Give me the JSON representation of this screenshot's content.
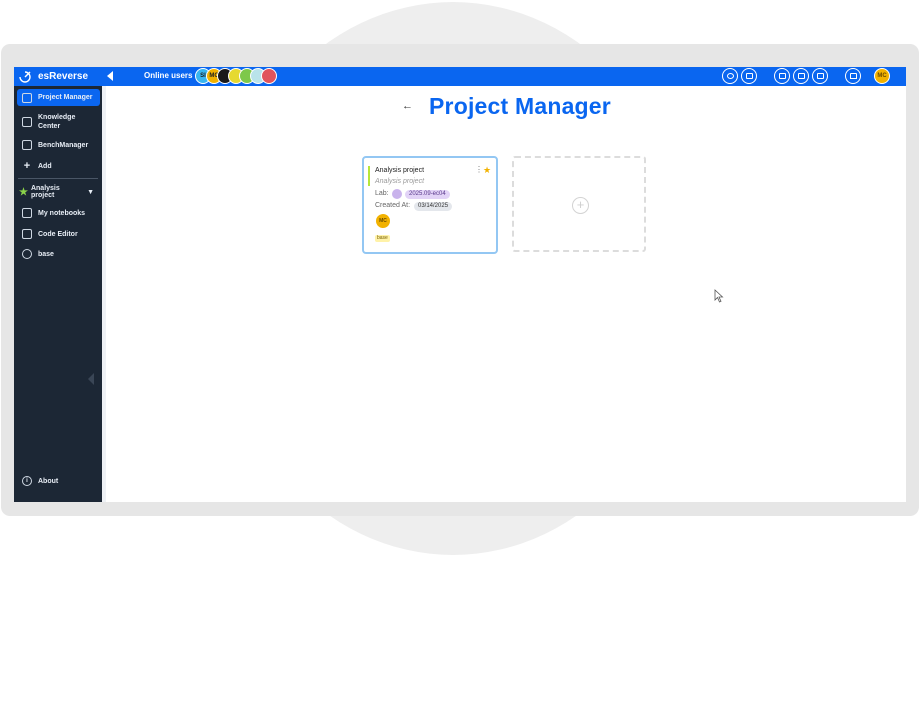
{
  "app": {
    "brand": "esReverse",
    "online_label": "Online users"
  },
  "online_avatars": [
    {
      "text": "SI",
      "color": "#39b6f0"
    },
    {
      "text": "MC",
      "color": "#f2b200"
    },
    {
      "text": "",
      "color": "#1a1a1a"
    },
    {
      "text": "",
      "color": "#e6d930"
    },
    {
      "text": "",
      "color": "#7ec84a"
    },
    {
      "text": "",
      "color": "#b9e3ea"
    },
    {
      "text": "",
      "color": "#e0545c"
    }
  ],
  "user_avatar": {
    "text": "MC",
    "color": "#f2b200"
  },
  "sidebar": {
    "items": [
      {
        "label": "Project Manager",
        "icon": "folder-icon",
        "active": true
      },
      {
        "label": "Knowledge Center",
        "icon": "graduation-cap-icon",
        "active": false
      },
      {
        "label": "BenchManager",
        "icon": "microscope-icon",
        "active": false
      },
      {
        "label": "Add",
        "icon": "plus-icon",
        "active": false
      }
    ],
    "project_section": {
      "label": "Analysis project"
    },
    "project_items": [
      {
        "label": "My notebooks",
        "icon": "notebook-icon"
      },
      {
        "label": "Code Editor",
        "icon": "code-icon"
      },
      {
        "label": "base",
        "icon": "docker-icon"
      }
    ],
    "about": "About"
  },
  "main": {
    "title": "Project Manager",
    "back_glyph": "←"
  },
  "project_card": {
    "name": "Analysis project",
    "description": "Analysis project",
    "lab_label": "Lab:",
    "lab_value": "2025.09-ec04",
    "created_label": "Created At:",
    "created_value": "03/14/2025",
    "owner": "MC",
    "tag": "base",
    "menu_glyph": "⋮",
    "star_glyph": "★"
  },
  "add_card": {
    "plus_glyph": "+"
  },
  "colors": {
    "accent": "#0a66f0",
    "sidebar_bg": "#1c2735",
    "card_border": "#93c7f3",
    "status_bar": "#b7e63a"
  }
}
